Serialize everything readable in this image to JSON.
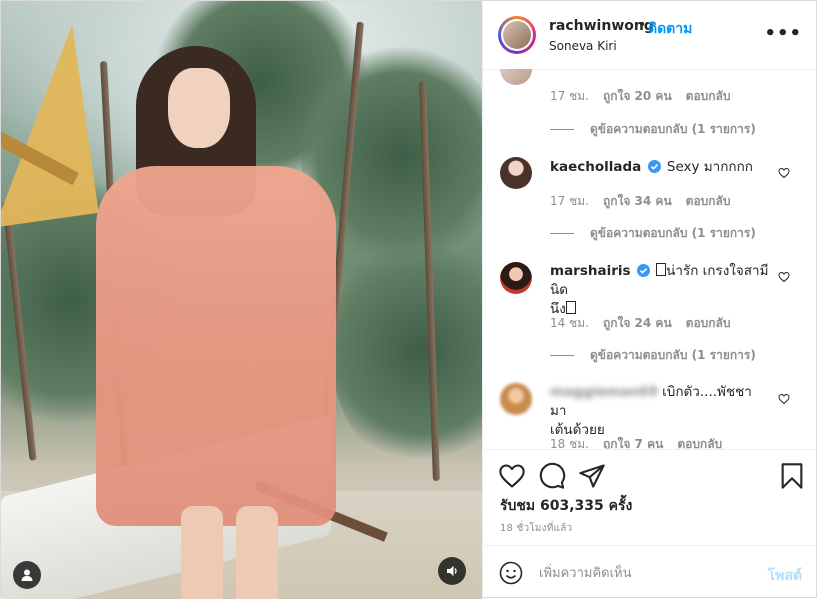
{
  "header": {
    "username": "rachwinwong",
    "separator": "•",
    "follow_label": "ติดตาม",
    "location": "Soneva Kiri",
    "more_label": "•••"
  },
  "comments": [
    {
      "text": "",
      "meta": {
        "time": "17 ชม.",
        "likes": "ถูกใจ 20 คน",
        "reply": "ตอบกลับ"
      },
      "view_replies": "ดูข้อความตอบกลับ (1 รายการ)"
    },
    {
      "username": "kaechollada",
      "text": "Sexy มากกกก",
      "meta": {
        "time": "17 ชม.",
        "likes": "ถูกใจ 34 คน",
        "reply": "ตอบกลับ"
      },
      "view_replies": "ดูข้อความตอบกลับ (1 รายการ)"
    },
    {
      "username": "marshairis",
      "text": "น่ารัก เกรงใจสามีนิด",
      "text2": "นึง",
      "meta": {
        "time": "14 ชม.",
        "likes": "ถูกใจ 24 คน",
        "reply": "ตอบกลับ"
      },
      "view_replies": "ดูข้อความตอบกลับ (1 รายการ)"
    },
    {
      "username": "maggieman69",
      "text": "เบิกตัว....พัชชา มา",
      "text2": "เต้นด้วยย",
      "meta": {
        "time": "18 ชม.",
        "likes": "ถูกใจ 7 คน",
        "reply": "ตอบกลับ"
      }
    }
  ],
  "likes": {
    "label": "รับชม",
    "count": "603,335",
    "suffix": "ครั้ง"
  },
  "timestamp": "18 ชั่วโมงที่แล้ว",
  "composer": {
    "placeholder": "เพิ่มความคิดเห็น",
    "post_label": "โพสต์"
  },
  "colors": {
    "accent": "#0095f6",
    "post_disabled": "#b2dffc",
    "verified": "#3897f0",
    "muted": "#8e8e8e"
  }
}
